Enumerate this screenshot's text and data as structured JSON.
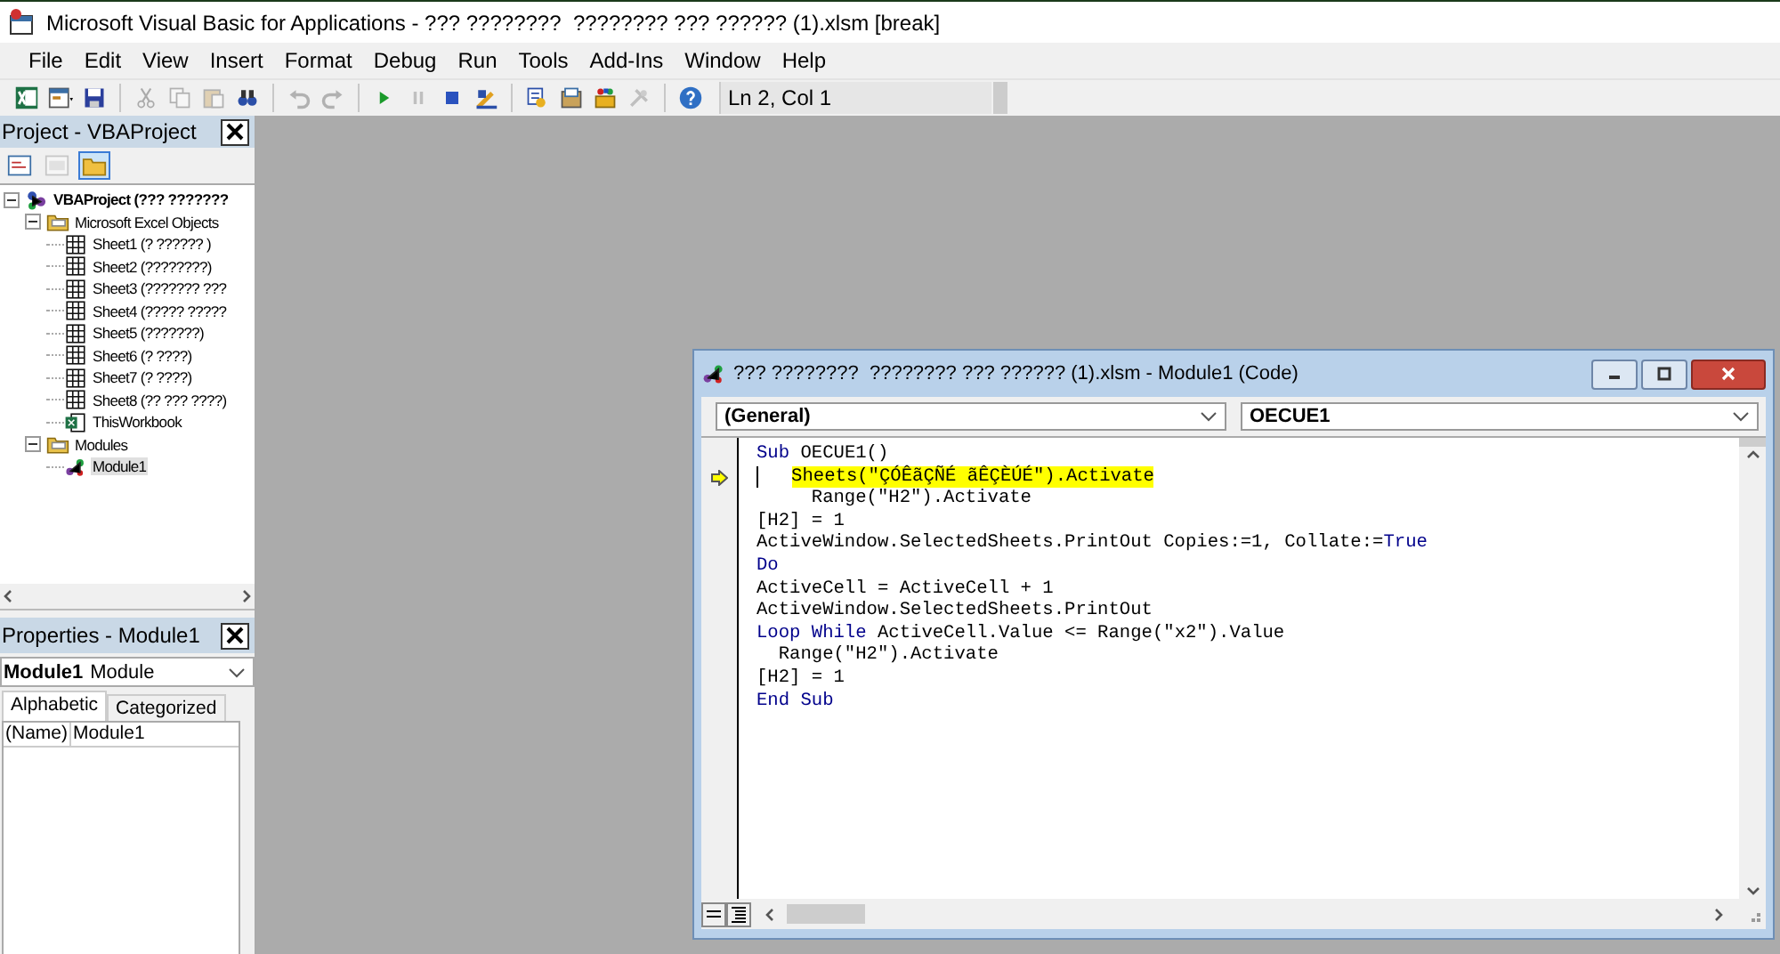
{
  "window": {
    "title": "Microsoft Visual Basic for Applications - ??? ????????  ???????? ??? ?????? (1).xlsm [break]"
  },
  "menu": [
    "File",
    "Edit",
    "View",
    "Insert",
    "Format",
    "Debug",
    "Run",
    "Tools",
    "Add-Ins",
    "Window",
    "Help"
  ],
  "toolbar": {
    "buttons": [
      {
        "kind": "excel",
        "disabled": false
      },
      {
        "kind": "userform",
        "disabled": false
      },
      {
        "kind": "save",
        "disabled": false
      },
      {
        "kind": "cut",
        "disabled": true
      },
      {
        "kind": "copy",
        "disabled": true
      },
      {
        "kind": "paste",
        "disabled": true
      },
      {
        "kind": "find",
        "disabled": false
      },
      {
        "kind": "undo",
        "disabled": true
      },
      {
        "kind": "redo",
        "disabled": true
      },
      {
        "kind": "run",
        "disabled": false
      },
      {
        "kind": "break",
        "disabled": true
      },
      {
        "kind": "reset",
        "disabled": false
      },
      {
        "kind": "design",
        "disabled": false
      },
      {
        "kind": "explorer",
        "disabled": false
      },
      {
        "kind": "properties",
        "disabled": false
      },
      {
        "kind": "browser",
        "disabled": false
      },
      {
        "kind": "toolbox",
        "disabled": true
      },
      {
        "kind": "help",
        "disabled": false
      }
    ],
    "position": "Ln 2, Col 1"
  },
  "project_panel": {
    "title": "Project - VBAProject",
    "buttons": [
      {
        "kind": "code",
        "disabled": false,
        "selected": false
      },
      {
        "kind": "object",
        "disabled": true,
        "selected": false
      },
      {
        "kind": "folders",
        "disabled": false,
        "selected": true
      }
    ],
    "tree": [
      {
        "label": "VBAProject (??? ???????",
        "kind": "project",
        "expanded": true,
        "selected": false,
        "children": [
          {
            "label": "Microsoft Excel Objects",
            "kind": "folder",
            "expanded": true,
            "selected": false,
            "children": [
              {
                "label": "Sheet1 (? ?????? )",
                "kind": "sheet",
                "selected": false
              },
              {
                "label": "Sheet2 (????????)",
                "kind": "sheet",
                "selected": false
              },
              {
                "label": "Sheet3 (??????? ???",
                "kind": "sheet",
                "selected": false
              },
              {
                "label": "Sheet4 (????? ?????",
                "kind": "sheet",
                "selected": false
              },
              {
                "label": "Sheet5 (???????)",
                "kind": "sheet",
                "selected": false
              },
              {
                "label": "Sheet6 (? ????)",
                "kind": "sheet",
                "selected": false
              },
              {
                "label": "Sheet7 (? ????)",
                "kind": "sheet",
                "selected": false
              },
              {
                "label": "Sheet8 (?? ??? ????)",
                "kind": "sheet",
                "selected": false
              },
              {
                "label": "ThisWorkbook",
                "kind": "workbook",
                "selected": false
              }
            ]
          },
          {
            "label": "Modules",
            "kind": "folder",
            "expanded": true,
            "selected": false,
            "children": [
              {
                "label": "Module1",
                "kind": "module",
                "selected": true
              }
            ]
          }
        ]
      }
    ]
  },
  "properties_panel": {
    "title": "Properties - Module1",
    "object_name": "Module1",
    "object_type": "Module",
    "tabs": [
      {
        "label": "Alphabetic",
        "selected": true
      },
      {
        "label": "Categorized",
        "selected": false
      }
    ],
    "rows": [
      {
        "name": "(Name)",
        "value": "Module1"
      }
    ]
  },
  "code_window": {
    "title": "??? ????????  ???????? ??? ?????? (1).xlsm - Module1 (Code)",
    "object_dropdown": "(General)",
    "procedure_dropdown": "OECUE1",
    "lines": [
      {
        "current": false,
        "tokens": [
          {
            "text": "Sub",
            "kind": "keyword"
          },
          {
            "text": " OECUE1()",
            "kind": "plain"
          }
        ]
      },
      {
        "current": true,
        "tokens": [
          {
            "text": "    Sheets(\"ÇÓÊãÇÑÉ ãÊÇÈÚÉ\").Activate",
            "kind": "plain"
          }
        ]
      },
      {
        "current": false,
        "tokens": [
          {
            "text": "     Range(\"H2\").Activate",
            "kind": "plain"
          }
        ]
      },
      {
        "current": false,
        "tokens": [
          {
            "text": "[H2] = 1",
            "kind": "plain"
          }
        ]
      },
      {
        "current": false,
        "tokens": [
          {
            "text": "ActiveWindow.SelectedSheets.PrintOut Copies:=1, Collate:=",
            "kind": "plain"
          },
          {
            "text": "True",
            "kind": "keyword"
          }
        ]
      },
      {
        "current": false,
        "tokens": [
          {
            "text": "Do",
            "kind": "keyword"
          }
        ]
      },
      {
        "current": false,
        "tokens": [
          {
            "text": "ActiveCell = ActiveCell + 1",
            "kind": "plain"
          }
        ]
      },
      {
        "current": false,
        "tokens": [
          {
            "text": "ActiveWindow.SelectedSheets.PrintOut",
            "kind": "plain"
          }
        ]
      },
      {
        "current": false,
        "tokens": [
          {
            "text": "Loop While",
            "kind": "keyword"
          },
          {
            "text": " ActiveCell.Value <= Range(\"x2\").Value",
            "kind": "plain"
          }
        ]
      },
      {
        "current": false,
        "tokens": [
          {
            "text": "  Range(\"H2\").Activate",
            "kind": "plain"
          }
        ]
      },
      {
        "current": false,
        "tokens": [
          {
            "text": "[H2] = 1",
            "kind": "plain"
          }
        ]
      },
      {
        "current": false,
        "tokens": [
          {
            "text": "End Sub",
            "kind": "keyword"
          }
        ]
      }
    ]
  }
}
